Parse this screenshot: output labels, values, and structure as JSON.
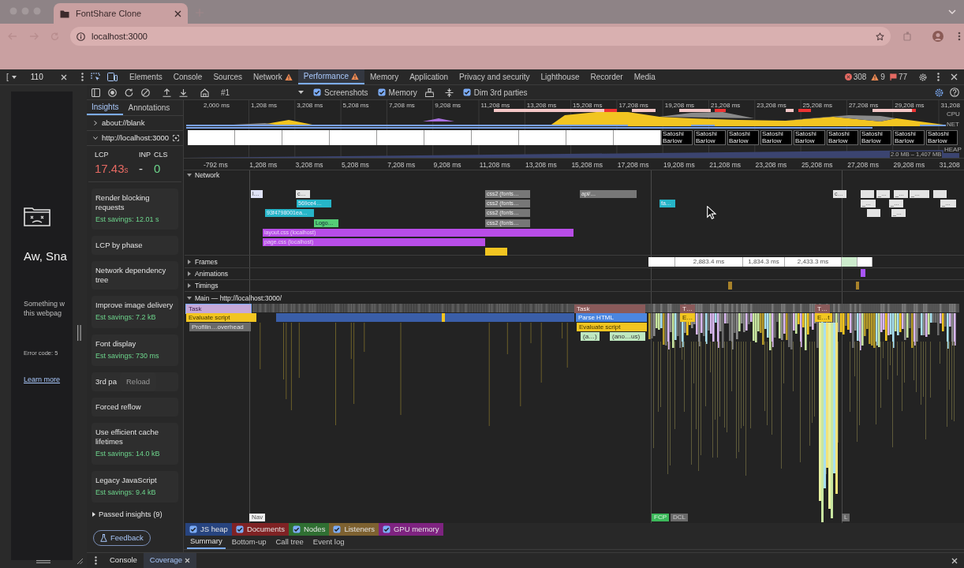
{
  "browser": {
    "tab_title": "FontShare Clone",
    "url": "localhost:3000"
  },
  "device_toolbar": {
    "preset": "[",
    "dimension": "110"
  },
  "devtools_tabs": [
    {
      "label": "Elements",
      "warning": false,
      "selected": false
    },
    {
      "label": "Console",
      "warning": false,
      "selected": false
    },
    {
      "label": "Sources",
      "warning": false,
      "selected": false
    },
    {
      "label": "Network",
      "warning": true,
      "selected": false
    },
    {
      "label": "Performance",
      "warning": true,
      "selected": true
    },
    {
      "label": "Memory",
      "warning": false,
      "selected": false
    },
    {
      "label": "Application",
      "warning": false,
      "selected": false
    },
    {
      "label": "Privacy and security",
      "warning": false,
      "selected": false
    },
    {
      "label": "Lighthouse",
      "warning": false,
      "selected": false
    },
    {
      "label": "Recorder",
      "warning": false,
      "selected": false
    },
    {
      "label": "Media",
      "warning": false,
      "selected": false
    }
  ],
  "counts": {
    "errors": "308",
    "warnings": "9",
    "issues": "77"
  },
  "perf_toolbar": {
    "recording": "#1",
    "options": [
      {
        "label": "Screenshots",
        "checked": true
      },
      {
        "label": "Memory",
        "checked": true
      },
      {
        "label": "Dim 3rd parties",
        "checked": true
      }
    ]
  },
  "page_preview": {
    "heading": "Aw, Sna",
    "message": [
      "Something w",
      "this webpag"
    ],
    "error_code": "Error code: 5",
    "link": "Learn more"
  },
  "insights": {
    "tabs": [
      {
        "label": "Insights",
        "selected": true
      },
      {
        "label": "Annotations",
        "selected": false
      }
    ],
    "pages": [
      {
        "label": "about://blank",
        "expanded": false
      },
      {
        "label": "http://localhost:3000",
        "expanded": true
      }
    ],
    "metrics": [
      {
        "name": "LCP",
        "value": "17.43",
        "unit": "s",
        "color": "#e46962"
      },
      {
        "name": "INP",
        "value": "-",
        "color": "#e3e3e3"
      },
      {
        "name": "CLS",
        "value": "0",
        "color": "#6dd58c"
      }
    ],
    "cards": [
      {
        "title": "Render blocking requests",
        "savings": "Est savings: 12.01 s"
      },
      {
        "title": "LCP by phase"
      },
      {
        "title": "Network dependency tree"
      },
      {
        "title": "Improve image delivery",
        "savings": "Est savings: 7.2 kB"
      },
      {
        "title": "Font display",
        "savings": "Est savings: 730 ms"
      },
      {
        "title": "3rd pa",
        "tooltip": "Reload"
      },
      {
        "title": "Forced reflow"
      },
      {
        "title": "Use efficient cache lifetimes",
        "savings": "Est savings: 14.0 kB"
      },
      {
        "title": "Legacy JavaScript",
        "savings": "Est savings: 9.4 kB"
      }
    ],
    "passed": "Passed insights (9)",
    "feedback": "Feedback"
  },
  "overview": {
    "ticks": [
      "2,000 ms",
      "1,208 ms",
      "3,208 ms",
      "5,208 ms",
      "7,208 ms",
      "9,208 ms",
      "11,208 ms",
      "13,208 ms",
      "15,208 ms",
      "17,208 ms",
      "19,208 ms",
      "21,208 ms",
      "23,208 ms",
      "25,208 ms",
      "27,208 ms",
      "29,208 ms",
      "31,208"
    ],
    "lanes": [
      "CPU",
      "NET",
      "HEAP"
    ],
    "heap_range": "2.0 MB – 1,407 MB",
    "screenshots": [
      {
        "kind": "blank"
      },
      {
        "kind": "blank"
      },
      {
        "kind": "blank"
      },
      {
        "kind": "blank"
      },
      {
        "kind": "blank"
      },
      {
        "kind": "blank"
      },
      {
        "kind": "blank"
      },
      {
        "kind": "blank"
      },
      {
        "kind": "blank"
      },
      {
        "kind": "blank"
      },
      {
        "kind": "text",
        "lines": [
          "Satoshi",
          "Barlow"
        ]
      },
      {
        "kind": "text",
        "lines": [
          "Satoshi",
          "Barlow"
        ]
      },
      {
        "kind": "text",
        "lines": [
          "Satoshi",
          "Barlow"
        ]
      },
      {
        "kind": "text",
        "lines": [
          "Satoshi",
          "Barlow"
        ]
      },
      {
        "kind": "text",
        "lines": [
          "Satoshi",
          "Barlow"
        ]
      },
      {
        "kind": "text",
        "lines": [
          "Satoshi",
          "Barlow"
        ]
      },
      {
        "kind": "text",
        "lines": [
          "Satoshi",
          "Barlow"
        ]
      },
      {
        "kind": "text",
        "lines": [
          "Satoshi",
          "Barlow"
        ]
      },
      {
        "kind": "text",
        "lines": [
          "Satoshi",
          "Barlow"
        ]
      }
    ]
  },
  "ruler": [
    "-792 ms",
    "1,208 ms",
    "3,208 ms",
    "5,208 ms",
    "7,208 ms",
    "9,208 ms",
    "11,208 ms",
    "13,208 ms",
    "15,208 ms",
    "17,208 ms",
    "19,208 ms",
    "21,208 ms",
    "23,208 ms",
    "25,208 ms",
    "27,208 ms",
    "29,208 ms",
    "31,208"
  ],
  "tracks": [
    {
      "label": "Network",
      "expanded": true
    },
    {
      "label": "Frames",
      "expanded": false
    },
    {
      "label": "Animations",
      "expanded": false
    },
    {
      "label": "Timings",
      "expanded": false
    },
    {
      "label": "Main — http://localhost:3000/",
      "expanded": true
    }
  ],
  "network_requests": [
    {
      "label": "l…",
      "kind": "document"
    },
    {
      "label": "c…",
      "kind": "other"
    },
    {
      "label": "569ce4…",
      "kind": "font"
    },
    {
      "label": "93f4798001ea…",
      "kind": "font"
    },
    {
      "label": "Logo…",
      "kind": "image"
    },
    {
      "label": "layout.css (localhost)",
      "kind": "stylesheet"
    },
    {
      "label": "page.css (localhost)",
      "kind": "stylesheet"
    },
    {
      "label": "css2 (fonts…",
      "kind": "third_party"
    },
    {
      "label": "css2 (fonts…",
      "kind": "third_party"
    },
    {
      "label": "css2 (fonts…",
      "kind": "third_party"
    },
    {
      "label": "css2 (fonts…",
      "kind": "third_party"
    },
    {
      "kind": "script"
    },
    {
      "label": "api/…",
      "kind": "third_party"
    },
    {
      "label": "fa…",
      "kind": "font"
    },
    {
      "label": "c…",
      "kind": "other"
    },
    {
      "kind": "other"
    },
    {
      "label": "_…",
      "kind": "other"
    },
    {
      "label": "_…",
      "kind": "other"
    },
    {
      "label": "_…",
      "kind": "other"
    },
    {
      "kind": "other"
    },
    {
      "label": "_…",
      "kind": "other"
    },
    {
      "label": "_…",
      "kind": "other"
    },
    {
      "label": "_…",
      "kind": "other"
    },
    {
      "kind": "other"
    },
    {
      "label": "_…",
      "kind": "other"
    }
  ],
  "frames": [
    {
      "kind": "frame"
    },
    {
      "kind": "frame",
      "duration": "2,883.4 ms"
    },
    {
      "kind": "frame",
      "duration": "1,834.3 ms"
    },
    {
      "kind": "frame",
      "duration": "2,433.3 ms"
    },
    {
      "kind": "partial"
    },
    {
      "kind": "frame"
    }
  ],
  "main_events": [
    {
      "label": "Task",
      "kind": "task",
      "selected": true
    },
    {
      "label": "Evaluate script",
      "kind": "script",
      "selected": false
    },
    {
      "label": "Profilin…overhead",
      "kind": "profiling",
      "selected": false
    },
    {
      "label": "Task",
      "kind": "task",
      "selected": false
    },
    {
      "label": "Parse HTML",
      "kind": "parse",
      "selected": false
    },
    {
      "label": "Evaluate script",
      "kind": "script",
      "selected": false
    },
    {
      "label": "(a…)",
      "kind": "function",
      "selected": false
    },
    {
      "label": "(ano…us)",
      "kind": "function",
      "selected": false
    },
    {
      "label": "T…",
      "kind": "task",
      "selected": false
    },
    {
      "label": "E…",
      "kind": "script",
      "selected": false
    },
    {
      "label": "T…",
      "kind": "task",
      "selected": false
    },
    {
      "label": "E…t",
      "kind": "script",
      "selected": false
    }
  ],
  "markers": [
    {
      "label": "Nav",
      "kind": "nav"
    },
    {
      "label": "FCP",
      "kind": "fcp"
    },
    {
      "label": "DCL",
      "kind": "dcl"
    },
    {
      "label": "L",
      "kind": "load"
    }
  ],
  "memory_counters": [
    {
      "label": "JS heap",
      "checked": true,
      "color": "#27447f"
    },
    {
      "label": "Documents",
      "checked": true,
      "color": "#7f2224"
    },
    {
      "label": "Nodes",
      "checked": true,
      "color": "#2f6f32"
    },
    {
      "label": "Listeners",
      "checked": true,
      "color": "#7d6130"
    },
    {
      "label": "GPU memory",
      "checked": true,
      "color": "#7e2380"
    }
  ],
  "detail_tabs": [
    {
      "label": "Summary",
      "selected": true
    },
    {
      "label": "Bottom-up",
      "selected": false
    },
    {
      "label": "Call tree",
      "selected": false
    },
    {
      "label": "Event log",
      "selected": false
    }
  ],
  "drawer_tabs": [
    {
      "label": "Console",
      "selected": false,
      "closable": false
    },
    {
      "label": "Coverage",
      "selected": true,
      "closable": true
    }
  ]
}
